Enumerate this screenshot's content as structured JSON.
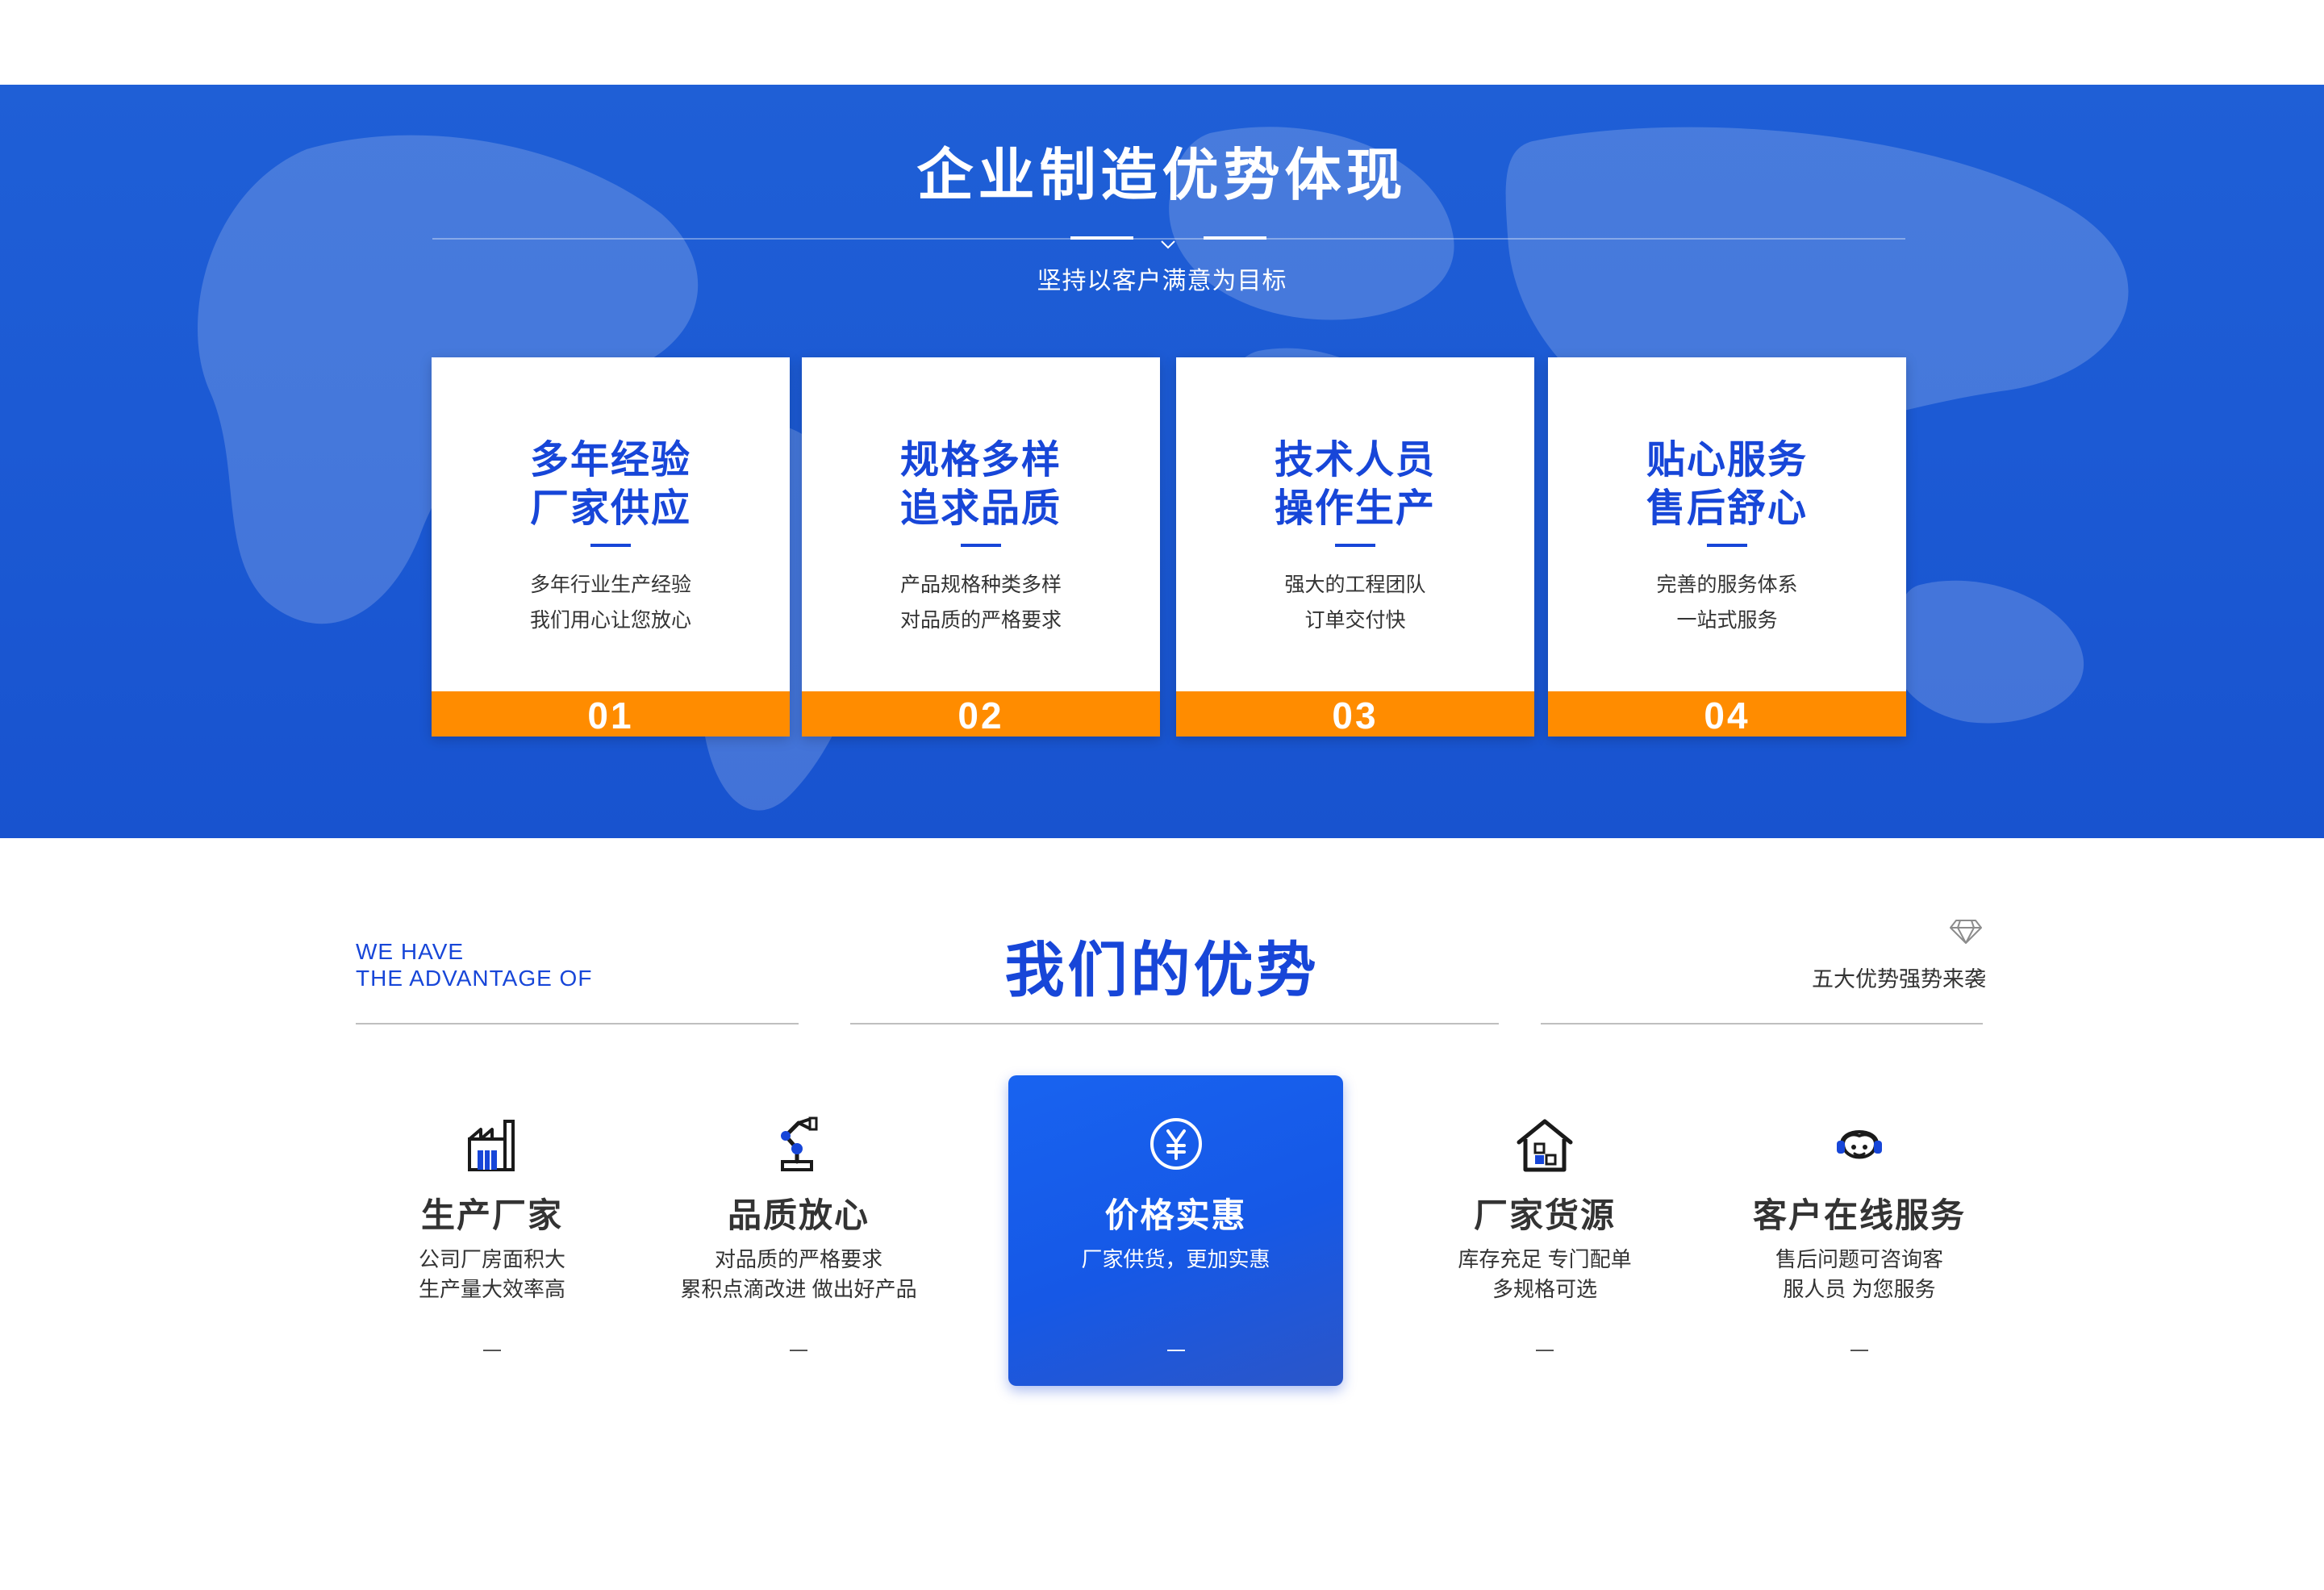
{
  "colors": {
    "brand_blue": "#1746d8",
    "band_blue": "#1c5ad4",
    "orange": "#ff8c00",
    "text_dark": "#333333"
  },
  "hero": {
    "title": "企业制造优势体现",
    "subtitle": "坚持以客户满意为目标"
  },
  "cards": [
    {
      "title_line1": "多年经验",
      "title_line2": "厂家供应",
      "desc_line1": "多年行业生产经验",
      "desc_line2": "我们用心让您放心",
      "number": "01"
    },
    {
      "title_line1": "规格多样",
      "title_line2": "追求品质",
      "desc_line1": "产品规格种类多样",
      "desc_line2": "对品质的严格要求",
      "number": "02"
    },
    {
      "title_line1": "技术人员",
      "title_line2": "操作生产",
      "desc_line1": "强大的工程团队",
      "desc_line2": "订单交付快",
      "number": "03"
    },
    {
      "title_line1": "贴心服务",
      "title_line2": "售后舒心",
      "desc_line1": "完善的服务体系",
      "desc_line2": "一站式服务",
      "number": "04"
    }
  ],
  "advantage": {
    "en_line1": "WE HAVE",
    "en_line2": "THE ADVANTAGE OF",
    "title": "我们的优势",
    "right_text": "五大优势强势来袭",
    "right_icon": "diamond-icon"
  },
  "features": [
    {
      "icon": "factory-icon",
      "title": "生产厂家",
      "desc_line1": "公司厂房面积大",
      "desc_line2": "生产量大效率高",
      "dash": "—"
    },
    {
      "icon": "robot-arm-icon",
      "title": "品质放心",
      "desc_line1": "对品质的严格要求",
      "desc_line2": "累积点滴改进 做出好产品",
      "dash": "—"
    },
    {
      "icon": "yen-icon",
      "title": "价格实惠",
      "desc_line1": "厂家供货，更加实惠",
      "desc_line2": "",
      "dash": "—",
      "active": true
    },
    {
      "icon": "warehouse-icon",
      "title": "厂家货源",
      "desc_line1": "库存充足 专门配单",
      "desc_line2": "多规格可选",
      "dash": "—"
    },
    {
      "icon": "customer-service-icon",
      "title": "客户在线服务",
      "desc_line1": "售后问题可咨询客",
      "desc_line2": "服人员 为您服务",
      "dash": "—"
    }
  ]
}
